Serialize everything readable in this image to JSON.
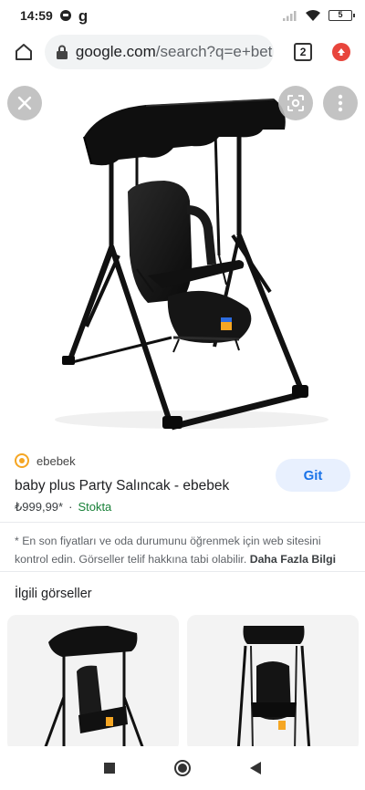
{
  "status_bar": {
    "time": "14:59",
    "carrier_letter": "g",
    "battery": "5"
  },
  "browser": {
    "url_host": "google.com",
    "url_path": "/search?q=e+bet",
    "tab_count": "2"
  },
  "result": {
    "source": "ebebek",
    "title": "baby plus Party Salıncak - ebebek",
    "price": "₺999,99*",
    "separator": "·",
    "stock": "Stokta",
    "visit_button": "Git",
    "disclaimer": "* En son fiyatları ve oda durumunu öğrenmek için web sitesini kontrol edin. Görseller telif hakkına tabi olabilir.",
    "more_info": "Daha Fazla Bilgi"
  },
  "related": {
    "title": "İlgili görseller"
  },
  "colors": {
    "accent": "#1a73e8",
    "stock_green": "#188038",
    "update_red": "#e8453c",
    "brand_orange": "#f5a623"
  }
}
